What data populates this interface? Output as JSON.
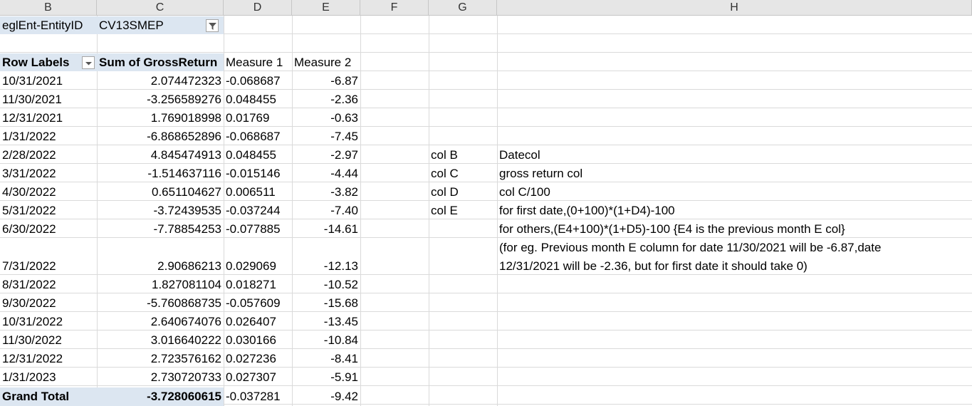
{
  "columns": [
    "B",
    "C",
    "D",
    "E",
    "F",
    "G",
    "H"
  ],
  "filter": {
    "label": "eglEnt-EntityID",
    "value": "CV13SMEP"
  },
  "pivot": {
    "headers": [
      "Row Labels",
      "Sum of GrossReturn",
      "Measure 1",
      "Measure 2"
    ],
    "rows": [
      {
        "date": "10/31/2021",
        "gross": "2.074472323",
        "m1": "-0.068687",
        "m2": "-6.87"
      },
      {
        "date": "11/30/2021",
        "gross": "-3.256589276",
        "m1": "0.048455",
        "m2": "-2.36"
      },
      {
        "date": "12/31/2021",
        "gross": "1.769018998",
        "m1": "0.01769",
        "m2": "-0.63"
      },
      {
        "date": "1/31/2022",
        "gross": "-6.868652896",
        "m1": "-0.068687",
        "m2": "-7.45"
      },
      {
        "date": "2/28/2022",
        "gross": "4.845474913",
        "m1": "0.048455",
        "m2": "-2.97"
      },
      {
        "date": "3/31/2022",
        "gross": "-1.514637116",
        "m1": "-0.015146",
        "m2": "-4.44"
      },
      {
        "date": "4/30/2022",
        "gross": "0.651104627",
        "m1": "0.006511",
        "m2": "-3.82"
      },
      {
        "date": "5/31/2022",
        "gross": "-3.72439535",
        "m1": "-0.037244",
        "m2": "-7.40"
      },
      {
        "date": "6/30/2022",
        "gross": "-7.78854253",
        "m1": "-0.077885",
        "m2": "-14.61"
      },
      {
        "date": "7/31/2022",
        "gross": "2.90686213",
        "m1": "0.029069",
        "m2": "-12.13"
      },
      {
        "date": "8/31/2022",
        "gross": "1.827081104",
        "m1": "0.018271",
        "m2": "-10.52"
      },
      {
        "date": "9/30/2022",
        "gross": "-5.760868735",
        "m1": "-0.057609",
        "m2": "-15.68"
      },
      {
        "date": "10/31/2022",
        "gross": "2.640674076",
        "m1": "0.026407",
        "m2": "-13.45"
      },
      {
        "date": "11/30/2022",
        "gross": "3.016640222",
        "m1": "0.030166",
        "m2": "-10.84"
      },
      {
        "date": "12/31/2022",
        "gross": "2.723576162",
        "m1": "0.027236",
        "m2": "-8.41"
      },
      {
        "date": "1/31/2023",
        "gross": "2.730720733",
        "m1": "0.027307",
        "m2": "-5.91"
      }
    ],
    "grand_total": {
      "label": "Grand Total",
      "gross": "-3.728060615",
      "m1": "-0.037281",
      "m2": "-9.42"
    }
  },
  "notes": {
    "g": [
      "col B",
      "col C",
      "col D",
      "col E"
    ],
    "h": [
      "Datecol",
      "gross return col",
      "col C/100",
      "for first date,(0+100)*(1+D4)-100",
      "for others,(E4+100)*(1+D5)-100  {E4 is the previous month E col}",
      "(for eg. Previous month E column for date 11/30/2021 will be -6.87,date",
      "12/31/2021 will be -2.36, but for first date it should take 0)"
    ]
  }
}
